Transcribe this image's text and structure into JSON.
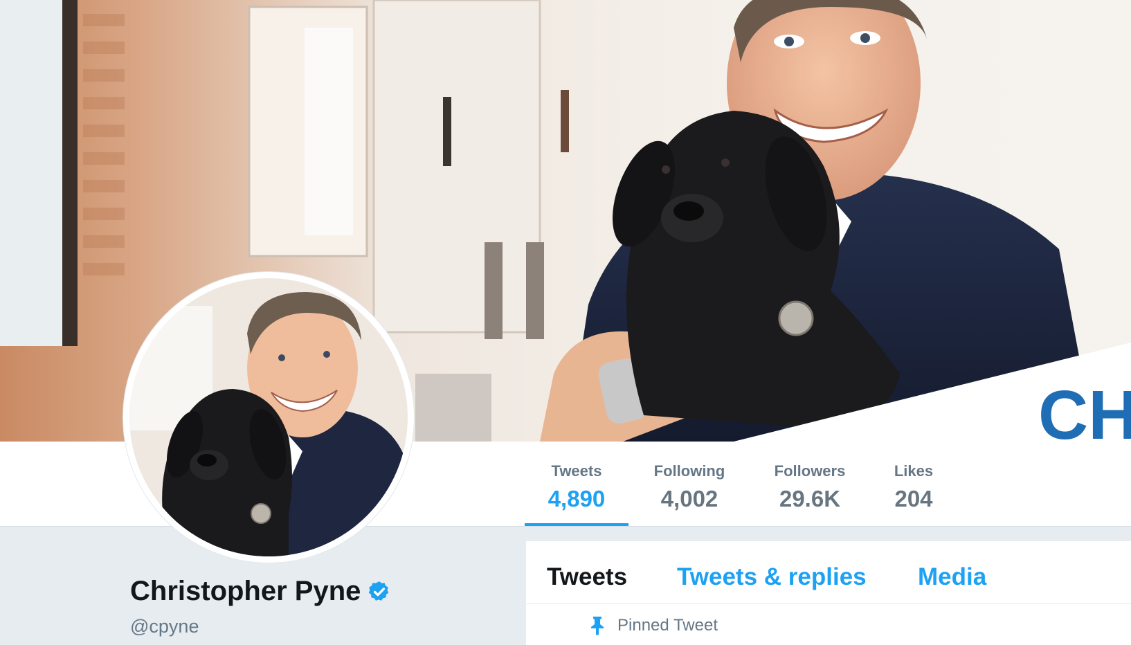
{
  "header": {
    "banner_text": "CH"
  },
  "stats": [
    {
      "label": "Tweets",
      "value": "4,890"
    },
    {
      "label": "Following",
      "value": "4,002"
    },
    {
      "label": "Followers",
      "value": "29.6K"
    },
    {
      "label": "Likes",
      "value": "204"
    }
  ],
  "profile": {
    "name": "Christopher Pyne",
    "handle": "@cpyne",
    "verified_icon": "verified-badge-icon"
  },
  "timeline": {
    "tabs": [
      {
        "label": "Tweets"
      },
      {
        "label": "Tweets & replies"
      },
      {
        "label": "Media"
      }
    ],
    "pinned_label": "Pinned Tweet"
  },
  "colors": {
    "accent": "#1da1f2",
    "text_primary": "#14171a",
    "text_secondary": "#657786",
    "background": "#e6ecf0"
  }
}
